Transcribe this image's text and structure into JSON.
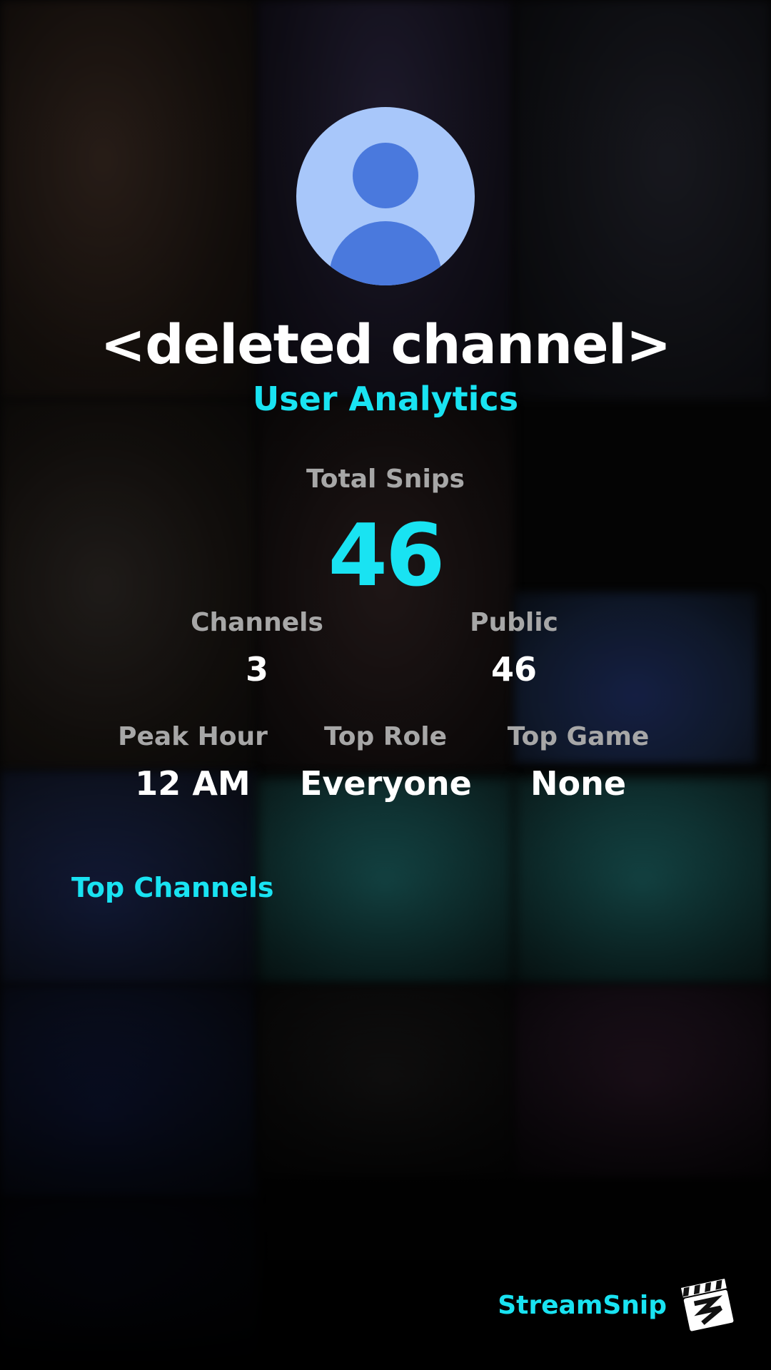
{
  "profile": {
    "channel_name": "<deleted channel>",
    "subtitle": "User Analytics",
    "avatar_icon": "default-user-avatar-icon",
    "avatar_colors": {
      "background": "#a8c7fa",
      "figure": "#4a79dd"
    }
  },
  "totals": {
    "label": "Total Snips",
    "value": "46"
  },
  "stats_row1": [
    {
      "label": "Channels",
      "value": "3"
    },
    {
      "label": "Public",
      "value": "46"
    }
  ],
  "stats_row2": [
    {
      "label": "Peak Hour",
      "value": "12 AM"
    },
    {
      "label": "Top Role",
      "value": "Everyone"
    },
    {
      "label": "Top Game",
      "value": "None"
    }
  ],
  "top_channels": {
    "heading": "Top Channels"
  },
  "brand": {
    "name": "StreamSnip",
    "logo_icon": "clapperboard-logo-icon"
  },
  "colors": {
    "accent": "#19e3f2",
    "label_gray": "#a7a7a7",
    "value_white": "#ffffff",
    "background": "#050505"
  }
}
